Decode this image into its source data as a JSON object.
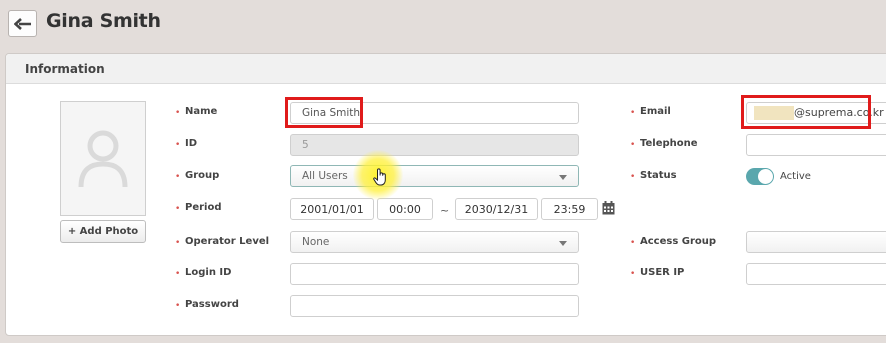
{
  "header": {
    "title": "Gina Smith",
    "back_icon": "arrow-left-icon"
  },
  "panel": {
    "title": "Information"
  },
  "photo": {
    "add_label": "+ Add Photo",
    "icon": "user-silhouette-icon"
  },
  "form": {
    "name": {
      "label": "Name",
      "value": "Gina Smith"
    },
    "id": {
      "label": "ID",
      "value": "5"
    },
    "group": {
      "label": "Group",
      "value": "All Users"
    },
    "period": {
      "label": "Period",
      "start_date": "2001/01/01",
      "start_time": "00:00",
      "separator": "~",
      "end_date": "2030/12/31",
      "end_time": "23:59",
      "calendar_icon": "calendar-icon"
    },
    "operator_level": {
      "label": "Operator Level",
      "value": "None"
    },
    "login_id": {
      "label": "Login ID",
      "value": ""
    },
    "password": {
      "label": "Password",
      "value": ""
    },
    "email": {
      "label": "Email",
      "domain": "@suprema.co.kr"
    },
    "telephone": {
      "label": "Telephone",
      "value": ""
    },
    "status": {
      "label": "Status",
      "value": "Active",
      "on": true
    },
    "access_group": {
      "label": "Access Group",
      "value": ""
    },
    "user_ip": {
      "label": "USER IP",
      "value": ""
    }
  },
  "colors": {
    "required_marker": "#d9534f",
    "highlight_box": "#e01b1b",
    "toggle_on": "#5aa7ad"
  }
}
